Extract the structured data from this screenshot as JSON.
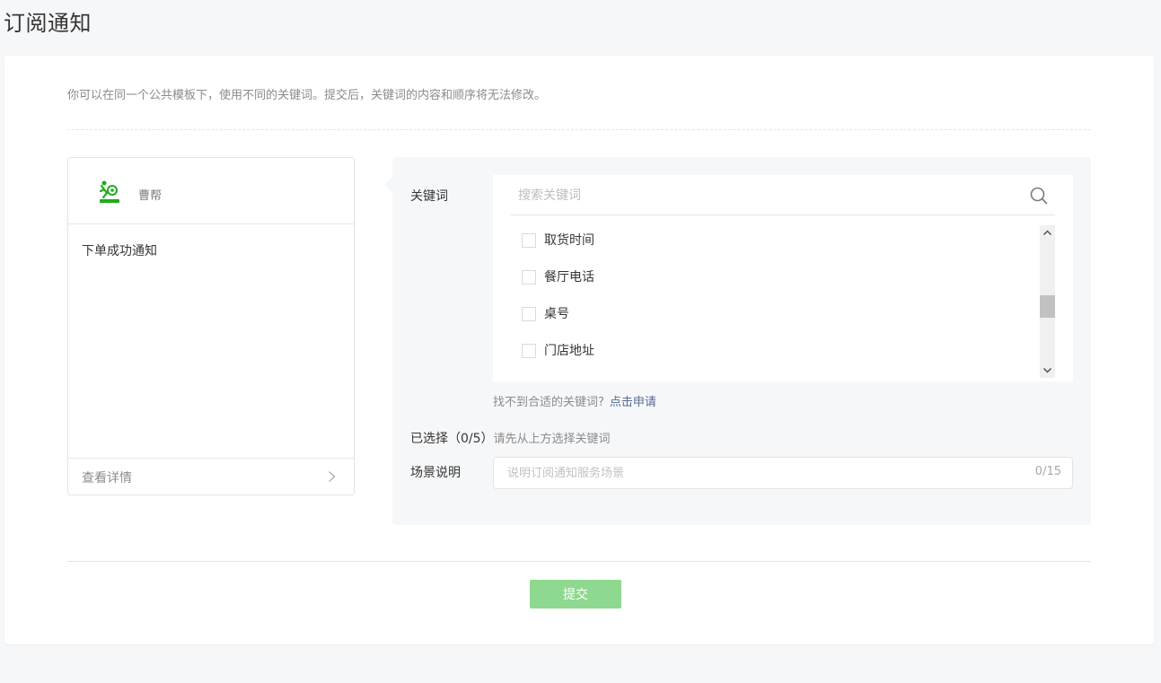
{
  "page": {
    "title": "订阅通知"
  },
  "tip": "你可以在同一个公共模板下，使用不同的关键词。提交后，关键词的内容和顺序将无法修改。",
  "preview": {
    "app_name": "曹帮",
    "template_title": "下单成功通知",
    "detail_label": "查看详情",
    "logo_color": "#1aad19"
  },
  "form": {
    "keyword_label": "关键词",
    "search_placeholder": "搜索关键词",
    "keywords": [
      {
        "label": "取货时间",
        "checked": false
      },
      {
        "label": "餐厅电话",
        "checked": false
      },
      {
        "label": "桌号",
        "checked": false
      },
      {
        "label": "门店地址",
        "checked": false
      }
    ],
    "not_found_text": "找不到合适的关键词?",
    "apply_link": "点击申请",
    "selected_label": "已选择（0/5）",
    "selected_hint": "请先从上方选择关键词",
    "scene_label": "场景说明",
    "scene_placeholder": "说明订阅通知服务场景",
    "scene_counter": "0/15"
  },
  "submit_label": "提交",
  "colors": {
    "accent": "#1aad19",
    "submit_disabled": "#8fd88f",
    "link": "#576b95"
  }
}
